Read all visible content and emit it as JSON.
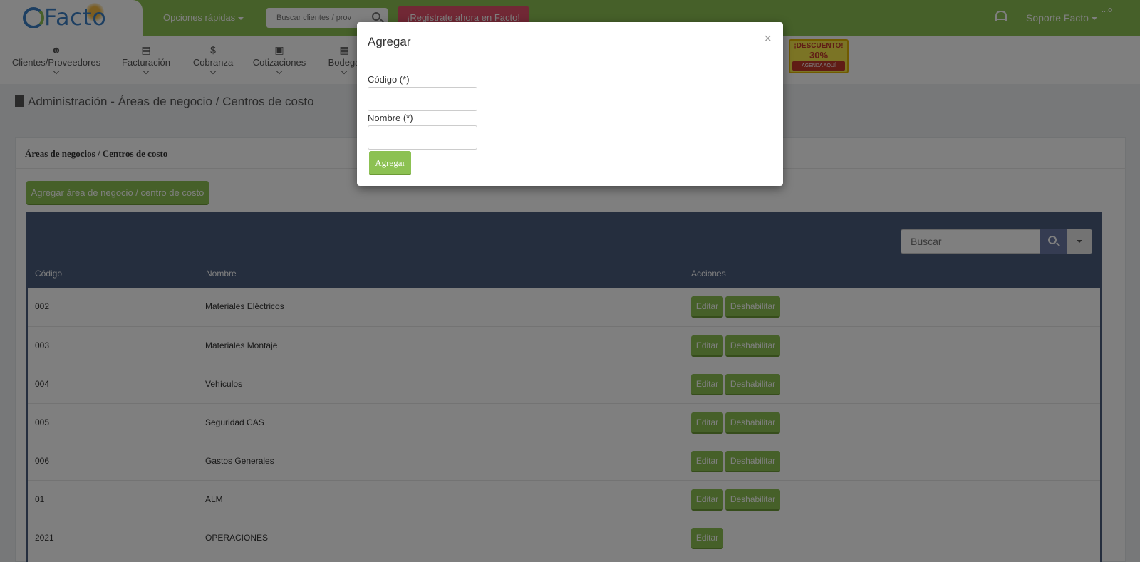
{
  "colors": {
    "brand_green": "#8cc152",
    "table_header": "#4a5c7d",
    "register_red": "#e3506b",
    "logo_blue": "#3b7fc4"
  },
  "brand": {
    "logo_text": "Facto"
  },
  "topbar": {
    "quick_options": "Opciones rápidas",
    "search_placeholder": "Buscar clientes / prov",
    "register_label": "¡Regístrate ahora en Facto!",
    "user_name": "Soporte Facto",
    "avatar_alt": "...o"
  },
  "nav": {
    "items": [
      {
        "label": "Clientes/Proveedores",
        "icon": "user-icon"
      },
      {
        "label": "Facturación",
        "icon": "document-icon"
      },
      {
        "label": "Cobranza",
        "icon": "dollar-icon"
      },
      {
        "label": "Cotizaciones",
        "icon": "cart-icon"
      },
      {
        "label": "Bodega",
        "icon": "boxes-icon"
      }
    ],
    "promo": {
      "line1": "¡DESCUENTO!",
      "line2": "30%",
      "line3": "AGENDA AQUÍ"
    }
  },
  "page": {
    "title": "Administración - Áreas de negocio / Centros de costo",
    "panel_title": "Áreas de negocios / Centros de costo",
    "add_button": "Agregar área de negocio / centro de costo"
  },
  "table": {
    "search_placeholder": "Buscar",
    "headers": {
      "code": "Código",
      "name": "Nombre",
      "actions": "Acciones"
    },
    "edit_label": "Editar",
    "disable_label": "Deshabilitar",
    "rows": [
      {
        "code": "002",
        "name": "Materiales Eléctricos",
        "can_disable": true
      },
      {
        "code": "003",
        "name": "Materiales Montaje",
        "can_disable": true
      },
      {
        "code": "004",
        "name": "Vehículos",
        "can_disable": true
      },
      {
        "code": "005",
        "name": "Seguridad CAS",
        "can_disable": true
      },
      {
        "code": "006",
        "name": "Gastos Generales",
        "can_disable": true
      },
      {
        "code": "01",
        "name": "ALM",
        "can_disable": true
      },
      {
        "code": "2021",
        "name": "OPERACIONES",
        "can_disable": false
      }
    ]
  },
  "modal": {
    "title": "Agregar",
    "close": "×",
    "code_label": "Código (*)",
    "code_value": "",
    "name_label": "Nombre (*)",
    "name_value": "",
    "submit_label": "Agregar"
  }
}
